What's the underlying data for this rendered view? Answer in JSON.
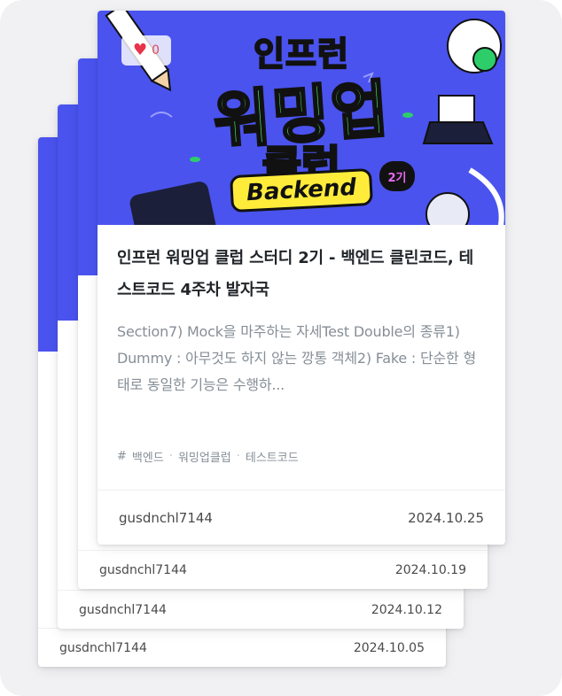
{
  "posts": [
    {
      "author": "gusdnchl7144",
      "date": "2024.10.25",
      "likes": "0",
      "title": "인프런 워밍업 클럽 스터디 2기 - 백엔드 클린코드, 테스트코드 4주차 발자국",
      "summary": " Section7) Mock을 마주하는 자세Test Double의 종류1) Dummy : 아무것도 하지 않는 깡통 객체2) Fake : 단순한 형태로 동일한 기능은 수행하...",
      "tag_prefix": "#",
      "tags": [
        "백엔드",
        "워밍업클럽",
        "테스트코드"
      ],
      "thumbnail": {
        "line1": "인프런",
        "line2": "워밍업",
        "line3": "클럽",
        "badge": "Backend",
        "gen": "2기"
      }
    },
    {
      "author": "gusdnchl7144",
      "date": "2024.10.19"
    },
    {
      "author": "gusdnchl7144",
      "date": "2024.10.12"
    },
    {
      "author": "gusdnchl7144",
      "date": "2024.10.05"
    }
  ],
  "colors": {
    "thumbnail_bg": "#4a53ee",
    "accent_green": "#4df06a",
    "badge_yellow": "#ffec3a",
    "heart": "#e8334a"
  },
  "icons": {
    "like": "heart-icon"
  }
}
